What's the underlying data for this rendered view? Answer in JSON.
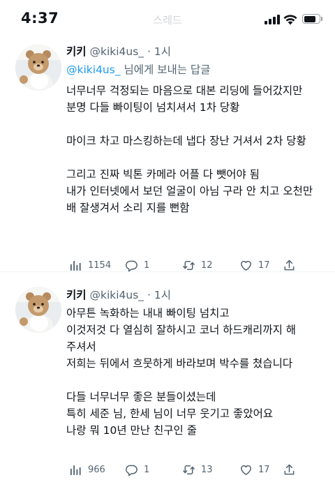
{
  "status_bar": {
    "time": "4:37",
    "faded_header": "스레드"
  },
  "tweets": [
    {
      "display_name": "키키",
      "handle": "@kiki4us_",
      "separator": "·",
      "time": "1시",
      "reply_to": {
        "mention": "@kiki4us_",
        "suffix": " 님에게 보내는 답글"
      },
      "lines": [
        "너무너무 걱정되는 마음으로 대본 리딩에 들어갔지만",
        "분명 다들 빠이팅이 넘치셔서 1차 당황",
        "",
        "마이크 차고 마스킹하는데 냅다 장난 거셔서 2차 당황",
        "",
        "그리고 진짜 빅톤 카메라 어플 다 뺏어야 됨",
        "내가 인터넷에서 보던 얼굴이 아님 구라 안 치고 오천만 배 잘생겨서 소리 지를 뻔함"
      ],
      "stats": {
        "views": "1154",
        "replies": "1",
        "retweets": "12",
        "likes": "17"
      }
    },
    {
      "display_name": "키키",
      "handle": "@kiki4us_",
      "separator": "·",
      "time": "1시",
      "lines": [
        "아무튼 녹화하는 내내 빠이팅 넘치고",
        "이것저것 다 열심히 잘하시고 코너 하드캐리까지 해 주셔서",
        "저희는 뒤에서 흐뭇하게 바라보며 박수를 쳤습니다",
        "",
        "다들 너무너무 좋은 분들이셨는데",
        "특히 세준 님, 한세 님이 너무 웃기고 좋았어요",
        "나랑 뭐 10년 만난 친구인 줄"
      ],
      "stats": {
        "views": "966",
        "replies": "1",
        "retweets": "13",
        "likes": "17"
      }
    }
  ],
  "colors": {
    "text": "#0f1419",
    "secondary": "#536471",
    "link": "#1d9bf0",
    "divider": "#eff3f4"
  },
  "icons": [
    "cellular-signal-icon",
    "wifi-icon",
    "battery-icon",
    "views-icon",
    "reply-icon",
    "retweet-icon",
    "like-icon",
    "share-icon"
  ]
}
